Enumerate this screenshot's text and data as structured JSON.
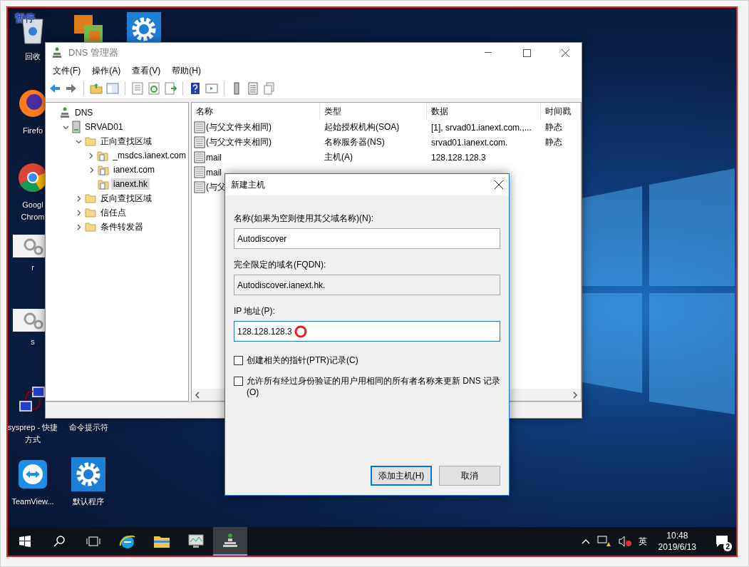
{
  "desktop": {
    "recorder_badge": "暂停",
    "icons": [
      {
        "kind": "recycle",
        "label": "回收"
      },
      {
        "kind": "firefox",
        "label": "Firefo"
      },
      {
        "kind": "chrome",
        "label": "Googl Chrom"
      },
      {
        "kind": "gears",
        "label": "r"
      },
      {
        "kind": "gears",
        "label": "s"
      },
      {
        "kind": "network",
        "label": "sysprep - 快捷方式"
      },
      {
        "kind": "teamviewer",
        "label": "TeamView..."
      },
      {
        "kind": "vm"
      },
      {
        "kind": "cmd",
        "label": "命令提示符"
      },
      {
        "kind": "gear",
        "label": "默认程序"
      },
      {
        "kind": "gear"
      }
    ]
  },
  "dns_window": {
    "title": "DNS 管理器",
    "menu": [
      "文件(F)",
      "操作(A)",
      "查看(V)",
      "帮助(H)"
    ],
    "tree": [
      {
        "label": "DNS",
        "kind": "dns",
        "selected": false,
        "children": [
          {
            "label": "SRVAD01",
            "kind": "server",
            "expanded": true,
            "selected": false,
            "children": [
              {
                "label": "正向查找区域",
                "kind": "folder",
                "expanded": true,
                "selected": false,
                "children": [
                  {
                    "label": "_msdcs.ianext.com",
                    "kind": "zone",
                    "expanded": false,
                    "selected": false
                  },
                  {
                    "label": "ianext.com",
                    "kind": "zone",
                    "expanded": false,
                    "selected": false
                  },
                  {
                    "label": "ianext.hk",
                    "kind": "zone",
                    "selected": true
                  }
                ]
              },
              {
                "label": "反向查找区域",
                "kind": "folder",
                "expanded": false,
                "selected": false
              },
              {
                "label": "信任点",
                "kind": "folder",
                "expanded": false,
                "selected": false
              },
              {
                "label": "条件转发器",
                "kind": "folder",
                "expanded": false,
                "selected": false
              }
            ]
          }
        ]
      }
    ],
    "table": {
      "columns": [
        "名称",
        "类型",
        "数据",
        "时间戳"
      ],
      "rows": [
        {
          "name": "(与父文件夹相同)",
          "type": "起始授权机构(SOA)",
          "data": "[1], srvad01.ianext.com.,...",
          "timestamp": "静态"
        },
        {
          "name": "(与父文件夹相同)",
          "type": "名称服务器(NS)",
          "data": "srvad01.ianext.com.",
          "timestamp": "静态"
        },
        {
          "name": "mail",
          "type": "主机(A)",
          "data": "128.128.128.3"
        },
        {
          "name": "mail"
        },
        {
          "name": "(与父"
        }
      ]
    }
  },
  "dialog": {
    "title": "新建主机",
    "fields": [
      {
        "label": "名称(如果为空则使用其父域名称)(N):",
        "value": "Autodiscover",
        "readonly": false,
        "focused": false
      },
      {
        "label": "完全限定的域名(FQDN):",
        "value": "Autodiscover.ianext.hk.",
        "readonly": true,
        "focused": false
      },
      {
        "label": "IP 地址(P):",
        "value": "128.128.128.3",
        "readonly": false,
        "focused": true
      }
    ],
    "checkboxes": [
      {
        "label": "创建相关的指针(PTR)记录(C)",
        "checked": false
      },
      {
        "label": "允许所有经过身份验证的用户用相同的所有者名称来更新 DNS 记录(O)",
        "checked": false
      }
    ],
    "buttons": [
      {
        "label": "添加主机(H)",
        "default": true
      },
      {
        "label": "取消",
        "default": false
      }
    ]
  },
  "taskbar": {
    "apps": [
      {
        "kind": "ie",
        "active": false
      },
      {
        "kind": "explorer",
        "active": false
      },
      {
        "kind": "monitor",
        "active": false
      },
      {
        "kind": "dns",
        "active": true
      }
    ],
    "ime": "英",
    "time": "10:48",
    "date": "2019/6/13",
    "notification_count": "2"
  }
}
